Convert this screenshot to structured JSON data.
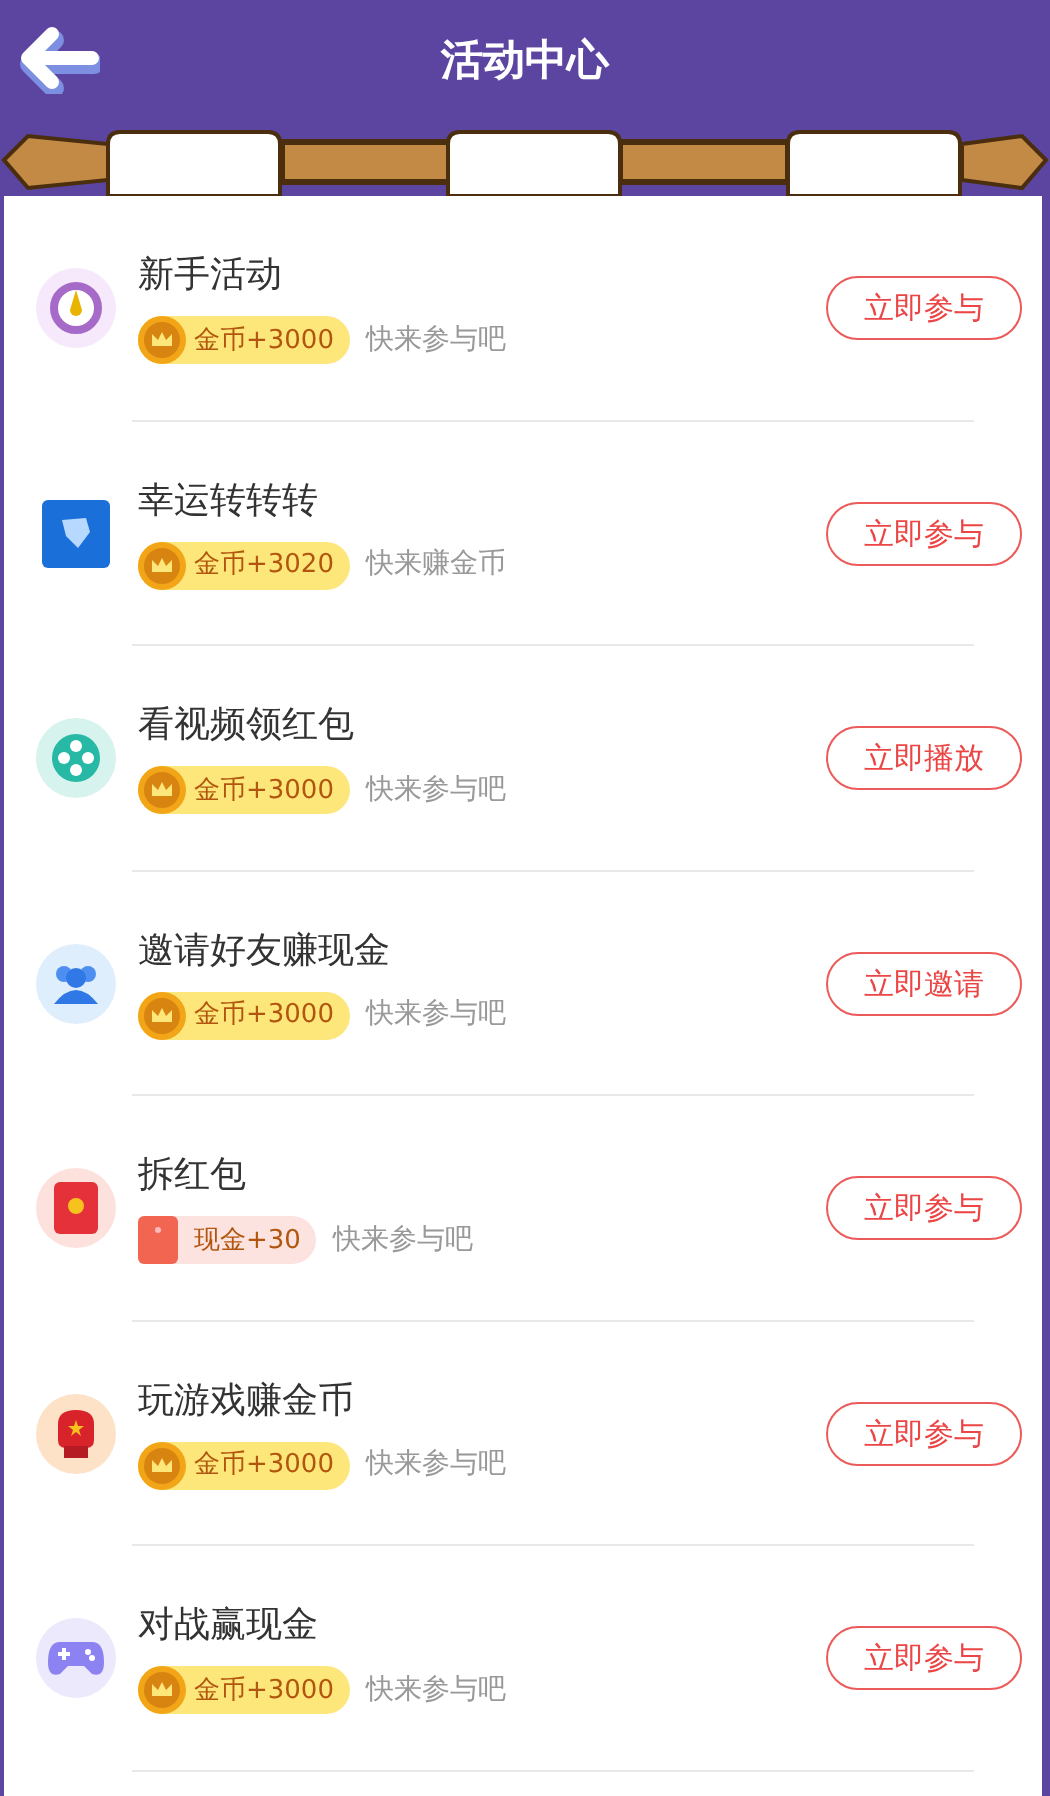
{
  "header": {
    "title": "活动中心"
  },
  "activities": [
    {
      "title": "新手活动",
      "reward": {
        "kind": "coin",
        "text": "金币+3000"
      },
      "subtitle": "快来参与吧",
      "button": "立即参与"
    },
    {
      "title": "幸运转转转",
      "reward": {
        "kind": "coin",
        "text": "金币+3020"
      },
      "subtitle": "快来赚金币",
      "button": "立即参与"
    },
    {
      "title": "看视频领红包",
      "reward": {
        "kind": "coin",
        "text": "金币+3000"
      },
      "subtitle": "快来参与吧",
      "button": "立即播放"
    },
    {
      "title": "邀请好友赚现金",
      "reward": {
        "kind": "coin",
        "text": "金币+3000"
      },
      "subtitle": "快来参与吧",
      "button": "立即邀请"
    },
    {
      "title": "拆红包",
      "reward": {
        "kind": "cash",
        "text": "现金+30"
      },
      "subtitle": "快来参与吧",
      "button": "立即参与"
    },
    {
      "title": "玩游戏赚金币",
      "reward": {
        "kind": "coin",
        "text": "金币+3000"
      },
      "subtitle": "快来参与吧",
      "button": "立即参与"
    },
    {
      "title": "对战赢现金",
      "reward": {
        "kind": "coin",
        "text": "金币+3000"
      },
      "subtitle": "快来参与吧",
      "button": "立即参与"
    }
  ]
}
